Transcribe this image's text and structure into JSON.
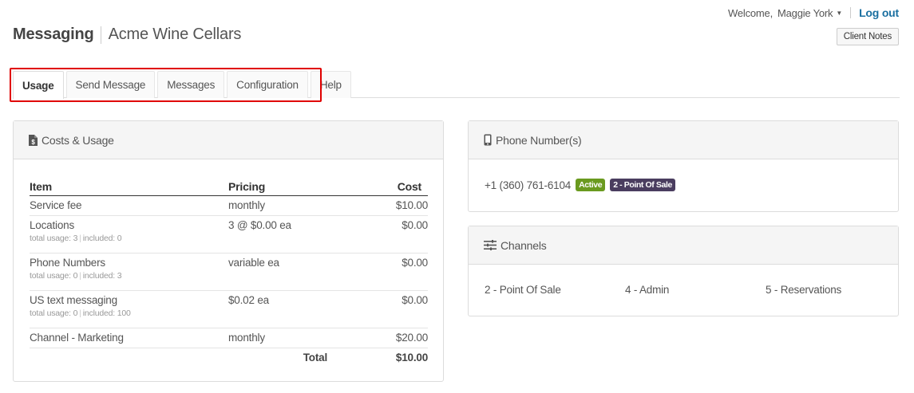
{
  "header": {
    "title": "Messaging",
    "subtitle": "Acme Wine Cellars",
    "welcome": "Welcome,",
    "user_name": "Maggie York",
    "logout": "Log out",
    "client_notes": "Client Notes"
  },
  "tabs": [
    {
      "label": "Usage",
      "active": true
    },
    {
      "label": "Send Message",
      "active": false
    },
    {
      "label": "Messages",
      "active": false
    },
    {
      "label": "Configuration",
      "active": false
    },
    {
      "label": "Help",
      "active": false
    }
  ],
  "costs": {
    "title": "Costs & Usage",
    "icon": "dollar-file-icon",
    "headers": {
      "item": "Item",
      "pricing": "Pricing",
      "cost": "Cost"
    },
    "rows": [
      {
        "item": "Service fee",
        "pricing": "monthly",
        "cost": "$10.00",
        "usage": "",
        "included": ""
      },
      {
        "item": "Locations",
        "pricing": "3 @ $0.00 ea",
        "cost": "$0.00",
        "usage": "total usage: 3",
        "included": "included: 0"
      },
      {
        "item": "Phone Numbers",
        "pricing": "variable ea",
        "cost": "$0.00",
        "usage": "total usage: 0",
        "included": "included: 3"
      },
      {
        "item": "US text messaging",
        "pricing": "$0.02 ea",
        "cost": "$0.00",
        "usage": "total usage: 0",
        "included": "included: 100"
      },
      {
        "item": "Channel - Marketing",
        "pricing": "monthly",
        "cost": "$20.00",
        "usage": "",
        "included": ""
      }
    ],
    "total_label": "Total",
    "total_value": "$10.00"
  },
  "phones": {
    "title": "Phone Number(s)",
    "icon": "mobile-phone-icon",
    "number": "+1 (360) 761-6104",
    "status_badge": "Active",
    "channel_badge": "2 - Point Of Sale"
  },
  "channels": {
    "title": "Channels",
    "icon": "sliders-icon",
    "items": [
      "2 - Point Of Sale",
      "4 - Admin",
      "5 - Reservations"
    ]
  },
  "colors": {
    "logout": "#1a6fa0",
    "active_badge": "#6a9a1f",
    "channel_badge": "#4a3d5f",
    "highlight": "#e00000"
  }
}
